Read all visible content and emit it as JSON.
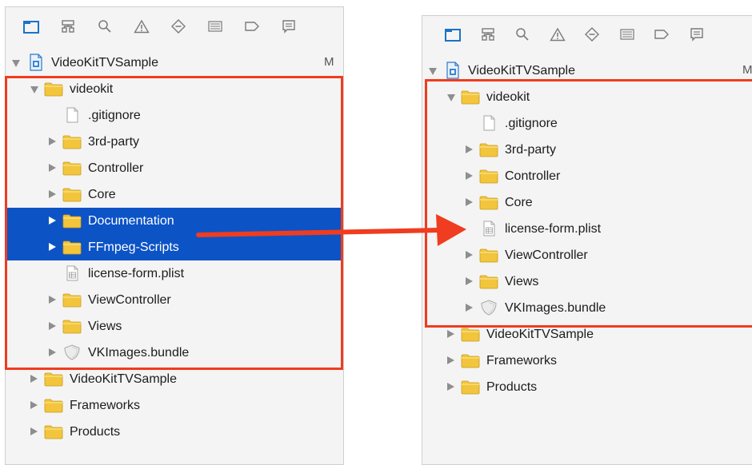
{
  "colors": {
    "folder": "#f2c53d",
    "selection": "#0c53c6",
    "highlight": "#f03c1f",
    "toolbar_active": "#1a73c8",
    "toolbar_icon": "#7a7a7a"
  },
  "toolbar_icons": [
    "project-navigator-icon",
    "symbol-navigator-icon",
    "find-navigator-icon",
    "issue-navigator-icon",
    "test-navigator-icon",
    "debug-navigator-icon",
    "breakpoint-navigator-icon",
    "report-navigator-icon"
  ],
  "before": {
    "project": {
      "name": "VideoKitTVSample",
      "badge": "M"
    },
    "items": [
      {
        "label": "videokit",
        "type": "folder",
        "disclosure": "open",
        "depth": 1,
        "selected": false
      },
      {
        "label": ".gitignore",
        "type": "file",
        "disclosure": "none",
        "depth": 2,
        "selected": false
      },
      {
        "label": "3rd-party",
        "type": "folder",
        "disclosure": "closed",
        "depth": 2,
        "selected": false
      },
      {
        "label": "Controller",
        "type": "folder",
        "disclosure": "closed",
        "depth": 2,
        "selected": false
      },
      {
        "label": "Core",
        "type": "folder",
        "disclosure": "closed",
        "depth": 2,
        "selected": false
      },
      {
        "label": "Documentation",
        "type": "folder",
        "disclosure": "closed",
        "depth": 2,
        "selected": true
      },
      {
        "label": "FFmpeg-Scripts",
        "type": "folder",
        "disclosure": "closed",
        "depth": 2,
        "selected": true
      },
      {
        "label": "license-form.plist",
        "type": "plist",
        "disclosure": "none",
        "depth": 2,
        "selected": false
      },
      {
        "label": "ViewController",
        "type": "folder",
        "disclosure": "closed",
        "depth": 2,
        "selected": false
      },
      {
        "label": "Views",
        "type": "folder",
        "disclosure": "closed",
        "depth": 2,
        "selected": false
      },
      {
        "label": "VKImages.bundle",
        "type": "bundle",
        "disclosure": "closed",
        "depth": 2,
        "selected": false
      },
      {
        "label": "VideoKitTVSample",
        "type": "folder",
        "disclosure": "closed",
        "depth": 1,
        "selected": false
      },
      {
        "label": "Frameworks",
        "type": "folder",
        "disclosure": "closed",
        "depth": 1,
        "selected": false
      },
      {
        "label": "Products",
        "type": "folder",
        "disclosure": "closed",
        "depth": 1,
        "selected": false
      }
    ]
  },
  "after": {
    "project": {
      "name": "VideoKitTVSample",
      "badge": "M"
    },
    "items": [
      {
        "label": "videokit",
        "type": "folder",
        "disclosure": "open",
        "depth": 1,
        "selected": false
      },
      {
        "label": ".gitignore",
        "type": "file",
        "disclosure": "none",
        "depth": 2,
        "selected": false
      },
      {
        "label": "3rd-party",
        "type": "folder",
        "disclosure": "closed",
        "depth": 2,
        "selected": false
      },
      {
        "label": "Controller",
        "type": "folder",
        "disclosure": "closed",
        "depth": 2,
        "selected": false
      },
      {
        "label": "Core",
        "type": "folder",
        "disclosure": "closed",
        "depth": 2,
        "selected": false
      },
      {
        "label": "license-form.plist",
        "type": "plist",
        "disclosure": "none",
        "depth": 2,
        "selected": false
      },
      {
        "label": "ViewController",
        "type": "folder",
        "disclosure": "closed",
        "depth": 2,
        "selected": false
      },
      {
        "label": "Views",
        "type": "folder",
        "disclosure": "closed",
        "depth": 2,
        "selected": false
      },
      {
        "label": "VKImages.bundle",
        "type": "bundle",
        "disclosure": "closed",
        "depth": 2,
        "selected": false
      },
      {
        "label": "VideoKitTVSample",
        "type": "folder",
        "disclosure": "closed",
        "depth": 1,
        "selected": false
      },
      {
        "label": "Frameworks",
        "type": "folder",
        "disclosure": "closed",
        "depth": 1,
        "selected": false
      },
      {
        "label": "Products",
        "type": "folder",
        "disclosure": "closed",
        "depth": 1,
        "selected": false
      }
    ]
  }
}
